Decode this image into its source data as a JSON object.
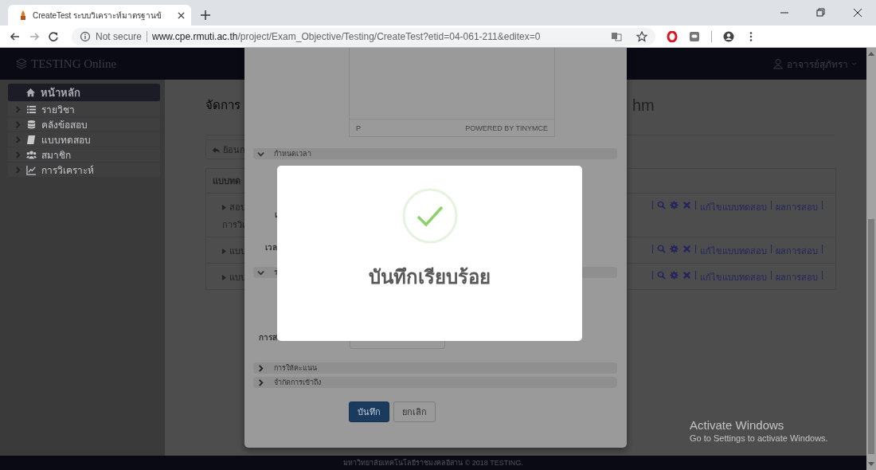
{
  "browser": {
    "tab_title": "CreateTest ระบบวิเคราะห์มาตรฐานข้",
    "security": "Not secure",
    "url_host": "www.cpe.rmuti.ac.th",
    "url_path": "/project/Exam_Objective/Testing/CreateTest?etid=04-061-211&editex=0"
  },
  "navbar": {
    "brand": "TESTING Online",
    "user": "อาจารย์สุภัทรา"
  },
  "sidebar": {
    "items": [
      {
        "label": "หน้าหลัก",
        "kind": "home",
        "selected": true
      },
      {
        "label": "รายวิชา",
        "kind": "list",
        "selected": false
      },
      {
        "label": "คลังข้อสอบ",
        "kind": "database",
        "selected": false
      },
      {
        "label": "แบบทดสอบ",
        "kind": "book",
        "selected": false
      },
      {
        "label": "สมาชิก",
        "kind": "users",
        "selected": false
      },
      {
        "label": "การวิเคราะห์",
        "kind": "chart",
        "selected": false
      }
    ]
  },
  "content": {
    "title_start": "จัดการ",
    "title_end": "hm",
    "back_button": "ย้อนก",
    "table": {
      "header": "แบบทด",
      "rows": [
        {
          "lines": [
            "สอบ",
            "การวิเ"
          ],
          "actions": [
            "แก้ไขแบบทดสอบ",
            "ผลการสอบ"
          ]
        },
        {
          "lines": [
            "แบบ"
          ],
          "actions": [
            "แก้ไขแบบทดสอบ",
            "ผลการสอบ"
          ]
        },
        {
          "lines": [
            "แบบ"
          ],
          "actions": [
            "แก้ไขแบบทดสอบ",
            "ผลการสอบ"
          ]
        }
      ]
    }
  },
  "modal": {
    "editor": {
      "path": "P",
      "branding": "POWERED BY TINYMCE"
    },
    "sections": [
      {
        "label": "กำหนดเวลา",
        "expanded": true,
        "fields": [
          "เ",
          "เวล"
        ]
      },
      {
        "label": "ร",
        "expanded": true,
        "fields": [
          "การส"
        ]
      },
      {
        "label": "การให้คะแนน",
        "expanded": false
      },
      {
        "label": "จำกัดการเข้าถึง",
        "expanded": false
      }
    ],
    "buttons": [
      {
        "label": "บันทึก",
        "kind": "primary"
      },
      {
        "label": "ยกเลิก",
        "kind": "default"
      }
    ]
  },
  "alert": {
    "title": "บันทึกเรียบร้อย"
  },
  "footer": "มหาวิทยาลัยเทคโนโลยีราชมงคลอีสาน © 2018 TESTING.",
  "os_notice": {
    "title": "Activate Windows",
    "text": "Go to Settings to activate Windows."
  }
}
